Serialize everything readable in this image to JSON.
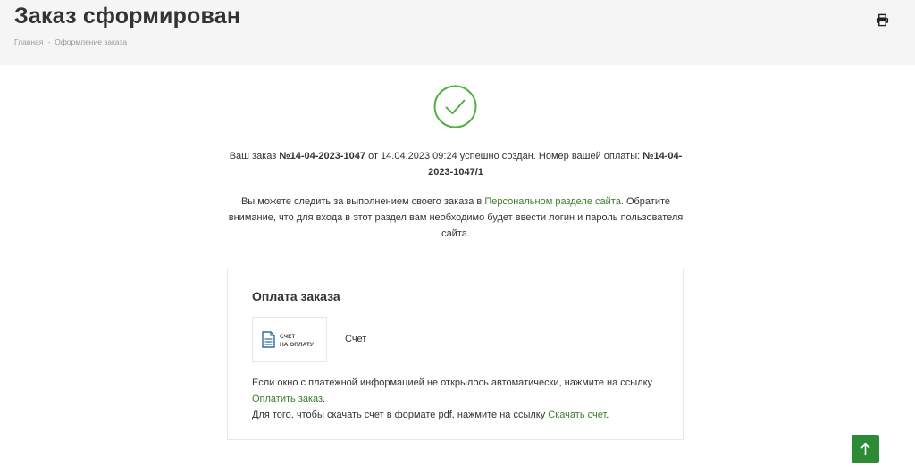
{
  "header": {
    "title": "Заказ сформирован",
    "breadcrumb": [
      "Главная",
      "Оформление заказа"
    ]
  },
  "confirmation": {
    "part1": "Ваш заказ ",
    "order_number": "№14-04-2023-1047",
    "part2": " от 14.04.2023 09:24 успешно создан. Номер вашей оплаты: ",
    "payment_number": "№14-04-2023-1047/1"
  },
  "tracking": {
    "part1": "Вы можете следить за выполнением своего заказа в ",
    "link": "Персональном разделе сайта",
    "part2": ". Обратите внимание, что для входа в этот раздел вам необходимо будет ввести логин и пароль пользователя сайта."
  },
  "payment": {
    "title": "Оплата заказа",
    "method_tile_text": "СЧЕТ\nНА ОПЛАТУ",
    "method_label": "Счет",
    "note1": "Если окно с платежной информацией не открылось автоматически, нажмите на ссылку ",
    "pay_link": "Оплатить заказ",
    "note1_end": ".",
    "note2": "Для того, чтобы скачать счет в формате pdf, нажмите на ссылку ",
    "download_link": "Скачать счет",
    "note2_end": "."
  },
  "icons": {
    "print": "printer-icon",
    "success": "check-circle-icon",
    "document": "document-icon",
    "scroll_up": "arrow-up-icon"
  },
  "colors": {
    "accent": "#3a7d2c",
    "success_circle": "#52b043",
    "scroll_button": "#2e8b35",
    "header_bg": "#f5f5f5"
  }
}
